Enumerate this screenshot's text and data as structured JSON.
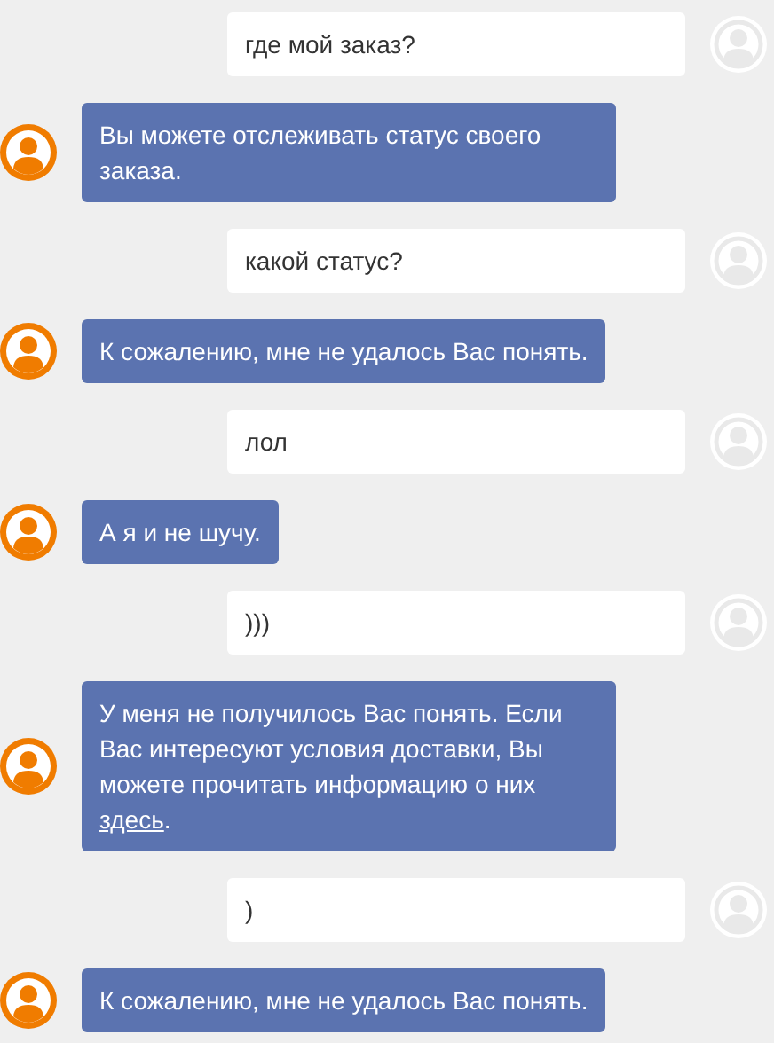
{
  "messages": [
    {
      "kind": "user",
      "text": "где мой заказ?"
    },
    {
      "kind": "bot",
      "text": "Вы можете отслеживать статус своего заказа."
    },
    {
      "kind": "user",
      "text": "какой статус?"
    },
    {
      "kind": "bot",
      "text": "К сожалению, мне не удалось Вас понять."
    },
    {
      "kind": "user",
      "text": "лол"
    },
    {
      "kind": "bot",
      "text": "А я и не шучу."
    },
    {
      "kind": "user",
      "text": ")))"
    },
    {
      "kind": "bot",
      "text": "У меня не получилось Вас понять. Если Вас интересуют условия доставки, Вы можете прочитать информацию о них",
      "link": "здесь",
      "text_after": "."
    },
    {
      "kind": "user",
      "text": ")"
    },
    {
      "kind": "bot",
      "text": "К сожалению, мне не удалось Вас понять."
    }
  ]
}
